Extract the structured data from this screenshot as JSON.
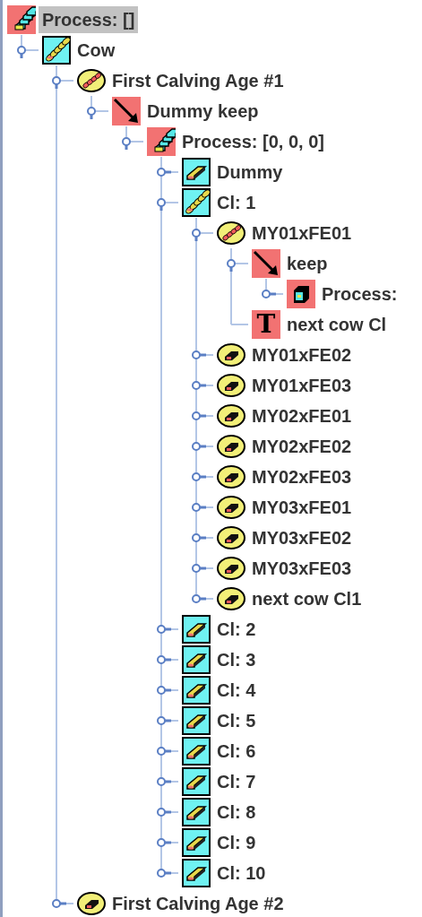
{
  "tree": {
    "label": "Process: []",
    "kind": "process",
    "selected": true,
    "children": [
      {
        "label": "Cow",
        "kind": "chain-box",
        "selected": false,
        "expanded": true,
        "children": [
          {
            "label": "First Calving Age #1",
            "kind": "chain-oval",
            "selected": false,
            "expanded": true,
            "children": [
              {
                "label": "Dummy keep",
                "kind": "arrow",
                "selected": false,
                "expanded": true,
                "children": [
                  {
                    "label": "Process: [0, 0, 0]",
                    "kind": "process",
                    "selected": false,
                    "expanded": true,
                    "children": [
                      {
                        "label": "Dummy",
                        "kind": "block-box",
                        "selected": false,
                        "expanded": false
                      },
                      {
                        "label": "Cl: 1",
                        "kind": "chain-box",
                        "selected": false,
                        "expanded": true,
                        "children": [
                          {
                            "label": "MY01xFE01",
                            "kind": "chain-oval",
                            "selected": false,
                            "expanded": true,
                            "children": [
                              {
                                "label": "keep",
                                "kind": "arrow",
                                "selected": false,
                                "expanded": true,
                                "children": [
                                  {
                                    "label": "Process:",
                                    "kind": "block-red",
                                    "selected": false,
                                    "expanded": false
                                  }
                                ]
                              },
                              {
                                "label": "next cow Cl",
                                "kind": "text",
                                "icon_text": "T",
                                "selected": false
                              }
                            ]
                          },
                          {
                            "label": "MY01xFE02",
                            "kind": "block-oval",
                            "selected": false,
                            "expanded": false
                          },
                          {
                            "label": "MY01xFE03",
                            "kind": "block-oval",
                            "selected": false,
                            "expanded": false
                          },
                          {
                            "label": "MY02xFE01",
                            "kind": "block-oval",
                            "selected": false,
                            "expanded": false
                          },
                          {
                            "label": "MY02xFE02",
                            "kind": "block-oval",
                            "selected": false,
                            "expanded": false
                          },
                          {
                            "label": "MY02xFE03",
                            "kind": "block-oval",
                            "selected": false,
                            "expanded": false
                          },
                          {
                            "label": "MY03xFE01",
                            "kind": "block-oval",
                            "selected": false,
                            "expanded": false
                          },
                          {
                            "label": "MY03xFE02",
                            "kind": "block-oval",
                            "selected": false,
                            "expanded": false
                          },
                          {
                            "label": "MY03xFE03",
                            "kind": "block-oval",
                            "selected": false,
                            "expanded": false
                          },
                          {
                            "label": "next cow Cl1",
                            "kind": "block-oval",
                            "selected": false,
                            "expanded": false
                          }
                        ]
                      },
                      {
                        "label": "Cl: 2",
                        "kind": "block-box",
                        "selected": false,
                        "expanded": false
                      },
                      {
                        "label": "Cl: 3",
                        "kind": "block-box",
                        "selected": false,
                        "expanded": false
                      },
                      {
                        "label": "Cl: 4",
                        "kind": "block-box",
                        "selected": false,
                        "expanded": false
                      },
                      {
                        "label": "Cl: 5",
                        "kind": "block-box",
                        "selected": false,
                        "expanded": false
                      },
                      {
                        "label": "Cl: 6",
                        "kind": "block-box",
                        "selected": false,
                        "expanded": false
                      },
                      {
                        "label": "Cl: 7",
                        "kind": "block-box",
                        "selected": false,
                        "expanded": false
                      },
                      {
                        "label": "Cl: 8",
                        "kind": "block-box",
                        "selected": false,
                        "expanded": false
                      },
                      {
                        "label": "Cl: 9",
                        "kind": "block-box",
                        "selected": false,
                        "expanded": false
                      },
                      {
                        "label": "Cl: 10",
                        "kind": "block-box",
                        "selected": false,
                        "expanded": false
                      }
                    ]
                  }
                ]
              }
            ]
          },
          {
            "label": "First Calving Age #2",
            "kind": "block-oval",
            "selected": false,
            "expanded": false
          }
        ]
      }
    ]
  }
}
